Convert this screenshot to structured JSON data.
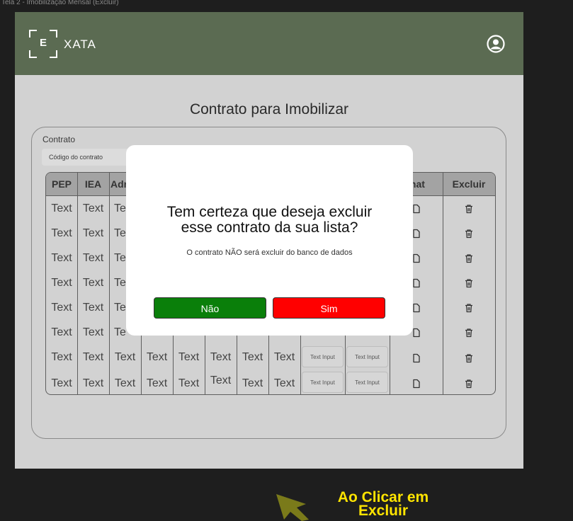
{
  "frame_label": "Tela 2 - Imobilização Mensal (Excluir)",
  "header": {
    "logo_letter": "E",
    "logo_name": "XATA",
    "user_icon": "user-circle-icon"
  },
  "page_title": "Contrato para Imobilizar",
  "contrato": {
    "label": "Contrato",
    "placeholder": "Código do contrato"
  },
  "table": {
    "headers": [
      "PEP",
      "IEA",
      "Adr",
      "mat",
      "Excluir"
    ],
    "rows_partial": [
      [
        "Text",
        "Text",
        "Te"
      ],
      [
        "Text",
        "Text",
        "Te"
      ],
      [
        "Text",
        "Text",
        "Te"
      ],
      [
        "Text",
        "Text",
        "Te"
      ],
      [
        "Text",
        "Text",
        "Te"
      ],
      [
        "Text",
        "Text",
        "Te"
      ]
    ],
    "rows_full": [
      [
        "Text",
        "Text",
        "Text",
        "Text",
        "Text",
        "Text",
        "Text",
        "Text",
        "Text Input",
        "Text Input"
      ],
      [
        "Text",
        "Text",
        "Text",
        "Text",
        "Text",
        "Text",
        "Text",
        "Text",
        "Text Input",
        "Text Input"
      ]
    ],
    "file_icon": "file-icon",
    "delete_icon": "trash-icon"
  },
  "modal": {
    "title_line1": "Tem certeza que deseja excluir",
    "title_line2": "esse contrato da sua lista?",
    "subtitle": "O contrato NÃO será excluir do banco de dados",
    "no_label": "Não",
    "yes_label": "Sim"
  },
  "annotation": {
    "line1": "Ao Clicar em",
    "line2": "Excluir"
  },
  "colors": {
    "topbar": "#5b6b52",
    "no": "#0a7f0a",
    "yes": "#ff0000",
    "annotation": "#ffe400",
    "arrow": "#7a7a1a"
  }
}
